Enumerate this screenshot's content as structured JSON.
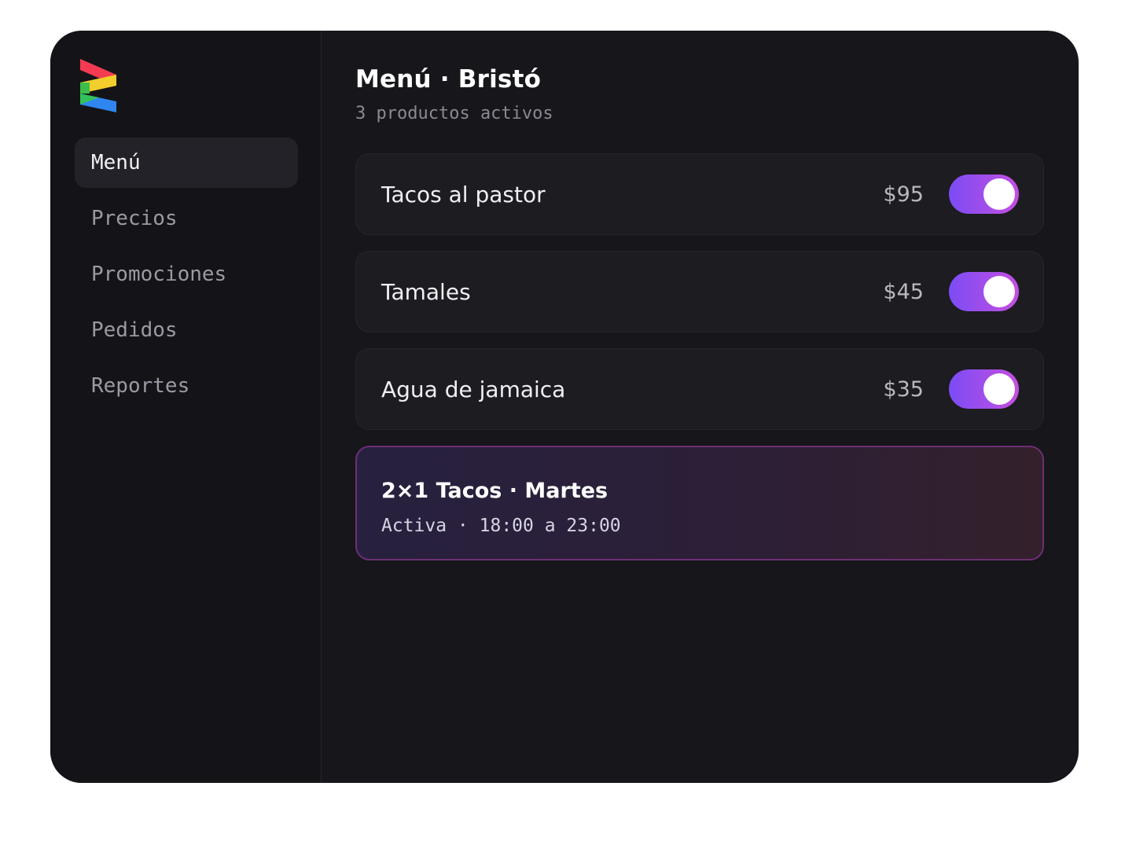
{
  "header": {
    "title": "Menú · Bristó",
    "subtitle": "3 productos activos"
  },
  "sidebar": {
    "logo_icon": "z-stripes-logo-icon",
    "items": [
      {
        "label": "Menú",
        "active": true
      },
      {
        "label": "Precios",
        "active": false
      },
      {
        "label": "Promociones",
        "active": false
      },
      {
        "label": "Pedidos",
        "active": false
      },
      {
        "label": "Reportes",
        "active": false
      }
    ]
  },
  "products": [
    {
      "name": "Tacos al pastor",
      "price": "$95",
      "enabled": true
    },
    {
      "name": "Tamales",
      "price": "$45",
      "enabled": true
    },
    {
      "name": "Agua de jamaica",
      "price": "$35",
      "enabled": true
    }
  ],
  "promo": {
    "title": "2×1 Tacos · Martes",
    "detail": "Activa · 18:00 a 23:00"
  },
  "colors": {
    "background": "#16161b",
    "sidebar": "#141418",
    "toggle_start": "#7b4cf5",
    "toggle_end": "#c54fe0",
    "promo_border": "#6e2f73"
  }
}
